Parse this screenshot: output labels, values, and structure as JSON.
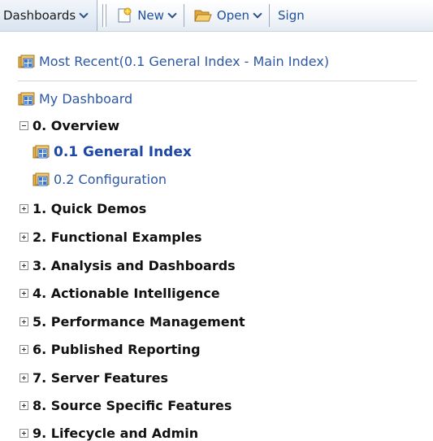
{
  "toolbar": {
    "dashboards_label": "Dashboards",
    "new_label": "New",
    "open_label": "Open",
    "sign_label": "Sign"
  },
  "tree": {
    "most_recent_label": "Most Recent(0.1 General Index - Main Index)",
    "my_dashboard_label": "My Dashboard",
    "sections": [
      {
        "label": "0. Overview",
        "expanded": true,
        "children": [
          {
            "label": "0.1 General Index",
            "current": true
          },
          {
            "label": "0.2 Configuration",
            "current": false
          }
        ]
      },
      {
        "label": "1. Quick Demos",
        "expanded": false
      },
      {
        "label": "2. Functional Examples",
        "expanded": false
      },
      {
        "label": "3. Analysis and Dashboards",
        "expanded": false
      },
      {
        "label": "4. Actionable Intelligence",
        "expanded": false
      },
      {
        "label": "5. Performance Management",
        "expanded": false
      },
      {
        "label": "6. Published Reporting",
        "expanded": false
      },
      {
        "label": "7. Server Features",
        "expanded": false
      },
      {
        "label": "8. Source Specific Features",
        "expanded": false
      },
      {
        "label": "9. Lifecycle and Admin",
        "expanded": false
      }
    ]
  },
  "colors": {
    "link": "#2d57a4",
    "current_link": "#1f48a6",
    "folder_icon": "#e8b14a"
  }
}
